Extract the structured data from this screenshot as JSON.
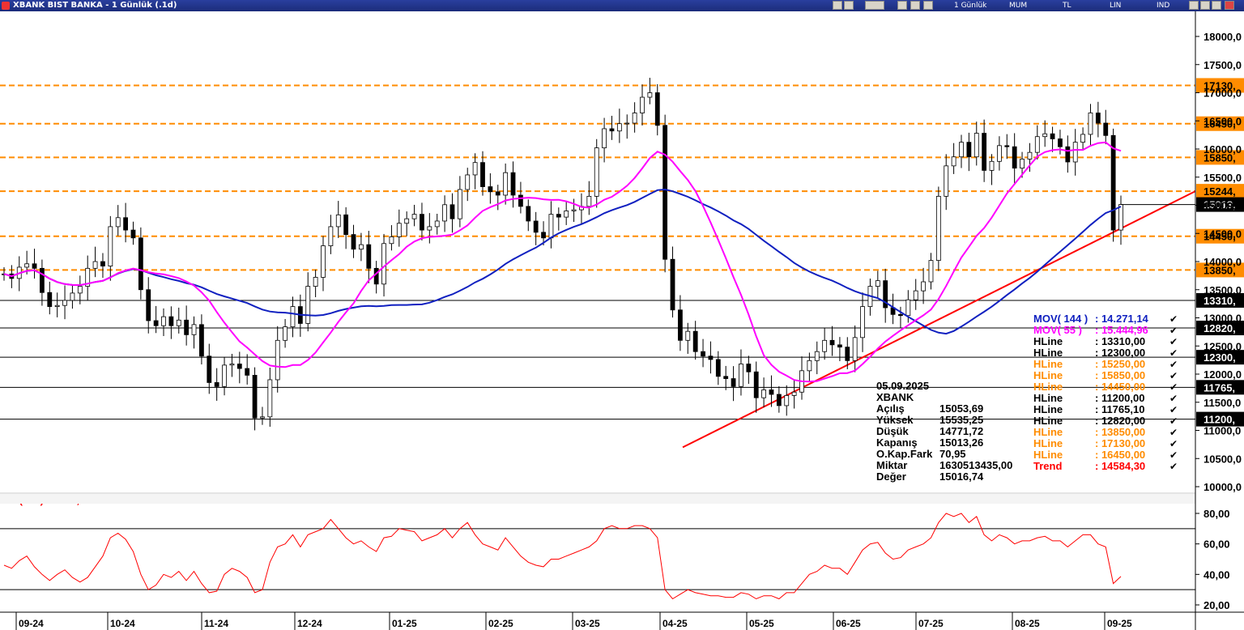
{
  "window": {
    "title": "XBANK BIST BANKA - 1 Günlük (.1d)",
    "toolbar": [
      "1 Günlük",
      "MUM",
      "TL",
      "LIN",
      "IND"
    ]
  },
  "chart_data": [
    {
      "type": "candlestick",
      "symbol": "XBANK",
      "x_ticks": [
        "09-24",
        "10-24",
        "11-24",
        "12-24",
        "01-25",
        "02-25",
        "03-25",
        "04-25",
        "05-25",
        "06-25",
        "07-25",
        "08-25",
        "09-25"
      ],
      "y_ticks": [
        "18000,0",
        "17500,0",
        "17000,0",
        "16500,0",
        "16000,0",
        "15500,0",
        "15000,0",
        "14500,0",
        "14000,0",
        "13500,0",
        "13000,0",
        "12500,0",
        "12000,0",
        "11500,0",
        "11000,0",
        "10500,0",
        "10000,0"
      ],
      "ylim": [
        10000,
        18000
      ],
      "price_tag": "15013,",
      "hlines_orange": [
        17130,
        16450,
        15850,
        15250,
        14450,
        13850
      ],
      "hline_orange_labels": [
        "17130,",
        "16450,",
        "15850,",
        "15244,",
        "14450,",
        "13850,"
      ],
      "hlines_black": [
        13310,
        12820,
        12300,
        11765.1,
        11200
      ],
      "hline_black_labels": [
        "13310,",
        "12820,",
        "12300,",
        "11765,",
        "11200,"
      ],
      "moving_averages": [
        {
          "name": "MOV( 144 )",
          "color": "#1020c0",
          "value": "14.271,14"
        },
        {
          "name": "MOV( 55 )",
          "color": "#ff00ff",
          "value": "15.444,96"
        }
      ],
      "trend": {
        "start": [
          "04-25",
          10700
        ],
        "end": [
          "09-25",
          15200
        ]
      },
      "series_closes": [
        13780,
        13700,
        13900,
        13960,
        13880,
        13450,
        13200,
        13220,
        13310,
        13440,
        13560,
        13880,
        14000,
        13920,
        14620,
        14780,
        14560,
        14420,
        13500,
        12950,
        12860,
        13020,
        12860,
        12960,
        12700,
        12880,
        12320,
        11850,
        11780,
        12160,
        12180,
        12100,
        11980,
        11220,
        11240,
        11900,
        12600,
        12840,
        13200,
        12900,
        13560,
        13720,
        14280,
        14620,
        14830,
        14480,
        14220,
        14300,
        13880,
        13600,
        14320,
        14440,
        14680,
        14760,
        14840,
        14560,
        14620,
        14720,
        15010,
        14760,
        15280,
        15540,
        15760,
        15330,
        15240,
        15180,
        15580,
        15180,
        14980,
        14720,
        14520,
        14420,
        14840,
        14790,
        14900,
        14920,
        14980,
        15160,
        16020,
        16360,
        16320,
        16450,
        16460,
        16640,
        16920,
        17000,
        16420,
        14040,
        13140,
        12600,
        12760,
        12400,
        12320,
        12260,
        11960,
        11920,
        11780,
        12180,
        12040,
        11580,
        11720,
        11640,
        11440,
        11620,
        11680,
        12060,
        12240,
        12400,
        12600,
        12520,
        12480,
        12240,
        12650,
        13200,
        13560,
        13660,
        13180,
        13060,
        13040,
        13320,
        13480,
        13640,
        14020,
        15160,
        15700,
        15860,
        16120,
        15860,
        16280,
        15620,
        15780,
        16060,
        16040,
        15660,
        15820,
        15940,
        16220,
        16270,
        16180,
        16040,
        15770,
        16120,
        16260,
        16640,
        16460,
        16240,
        14560,
        15013.26
      ],
      "info": {
        "date": "05.09.2025",
        "symbol": "XBANK",
        "rows": [
          {
            "label": "Açılış",
            "value": "15053,69"
          },
          {
            "label": "Yüksek",
            "value": "15535,25"
          },
          {
            "label": "Düşük",
            "value": "14771,72"
          },
          {
            "label": "Kapanış",
            "value": "15013,26"
          },
          {
            "label": "O.Kap.Fark",
            "value": "70,95"
          },
          {
            "label": "Miktar",
            "value": "1630513435,00"
          },
          {
            "label": "Değer",
            "value": "15016,74"
          }
        ]
      },
      "legend": [
        {
          "label": "MOV( 144 )",
          "value": ": 14.271,14",
          "color": "#1020c0"
        },
        {
          "label": "MOV( 55 )",
          "value": ": 15.444,96",
          "color": "#ff00ff"
        },
        {
          "label": "HLine",
          "value": ": 13310,00",
          "color": "#000000"
        },
        {
          "label": "HLine",
          "value": ": 12300,00",
          "color": "#000000"
        },
        {
          "label": "HLine",
          "value": ": 15250,00",
          "color": "#ff8c00"
        },
        {
          "label": "HLine",
          "value": ": 15850,00",
          "color": "#ff8c00"
        },
        {
          "label": "HLine",
          "value": ": 14450,00",
          "color": "#ff8c00"
        },
        {
          "label": "HLine",
          "value": ": 11200,00",
          "color": "#000000"
        },
        {
          "label": "HLine",
          "value": ": 11765,10",
          "color": "#000000"
        },
        {
          "label": "HLine",
          "value": ": 12820,00",
          "color": "#000000"
        },
        {
          "label": "HLine",
          "value": ": 13850,00",
          "color": "#ff8c00"
        },
        {
          "label": "HLine",
          "value": ": 17130,00",
          "color": "#ff8c00"
        },
        {
          "label": "HLine",
          "value": ": 16450,00",
          "color": "#ff8c00"
        },
        {
          "label": "Trend",
          "value": ": 14584,30",
          "color": "#ff0000"
        }
      ]
    },
    {
      "type": "line",
      "name": "RSI( 14 )",
      "value_label": ": 38,63",
      "color": "#ff0000",
      "y_ticks": [
        "80,00",
        "60,00",
        "40,00",
        "20,00"
      ],
      "ylim": [
        15,
        87
      ],
      "hlines": [
        70,
        30
      ],
      "values": [
        46,
        44,
        49,
        52,
        45,
        40,
        36,
        40,
        43,
        38,
        35,
        38,
        45,
        52,
        64,
        67,
        63,
        55,
        40,
        30,
        33,
        40,
        38,
        42,
        36,
        42,
        34,
        28,
        29,
        40,
        44,
        42,
        38,
        28,
        30,
        48,
        58,
        60,
        66,
        58,
        66,
        68,
        70,
        76,
        70,
        64,
        60,
        62,
        58,
        55,
        64,
        65,
        70,
        69,
        68,
        62,
        64,
        66,
        70,
        64,
        70,
        74,
        66,
        60,
        58,
        56,
        64,
        58,
        52,
        48,
        46,
        45,
        50,
        50,
        52,
        54,
        56,
        58,
        62,
        70,
        72,
        70,
        70,
        72,
        72,
        70,
        64,
        30,
        24,
        27,
        30,
        28,
        27,
        26,
        26,
        25,
        25,
        28,
        27,
        24,
        26,
        26,
        24,
        28,
        28,
        34,
        40,
        42,
        46,
        44,
        44,
        40,
        48,
        56,
        60,
        61,
        54,
        50,
        51,
        56,
        58,
        60,
        64,
        74,
        80,
        78,
        80,
        74,
        78,
        66,
        62,
        66,
        64,
        60,
        62,
        62,
        64,
        65,
        62,
        62,
        58,
        62,
        66,
        66,
        60,
        58,
        34,
        38.63
      ]
    }
  ]
}
